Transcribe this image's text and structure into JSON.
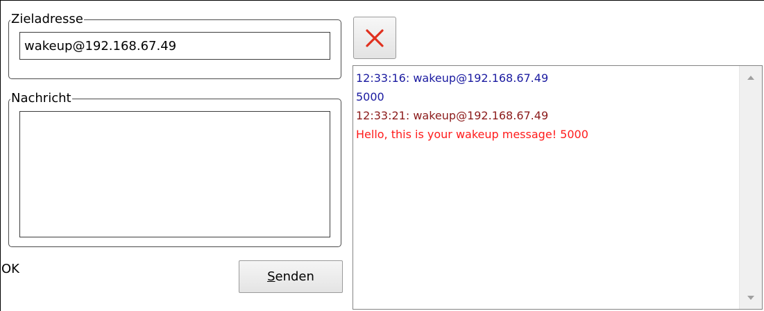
{
  "target_group": {
    "legend": "Zieladresse",
    "address_value": "wakeup@192.168.67.49"
  },
  "message_group": {
    "legend": "Nachricht",
    "message_value": ""
  },
  "status": {
    "text": "OK"
  },
  "send_button": {
    "label_prefix": "",
    "label_accel": "S",
    "label_rest": "enden"
  },
  "clear_button": {
    "icon": "close-icon",
    "color": "#e0301e"
  },
  "log": {
    "lines": [
      {
        "text": "12:33:16: wakeup@192.168.67.49",
        "color": "#1a1aa0"
      },
      {
        "text": "5000",
        "color": "#1a1aa0"
      },
      {
        "text": "12:33:21: wakeup@192.168.67.49",
        "color": "#8b1a1a"
      },
      {
        "text": "Hello, this is your wakeup message! 5000",
        "color": "#ff1a1a"
      }
    ]
  },
  "scrollbar": {
    "up_icon": "scroll-up-arrow-icon",
    "down_icon": "scroll-down-arrow-icon"
  }
}
